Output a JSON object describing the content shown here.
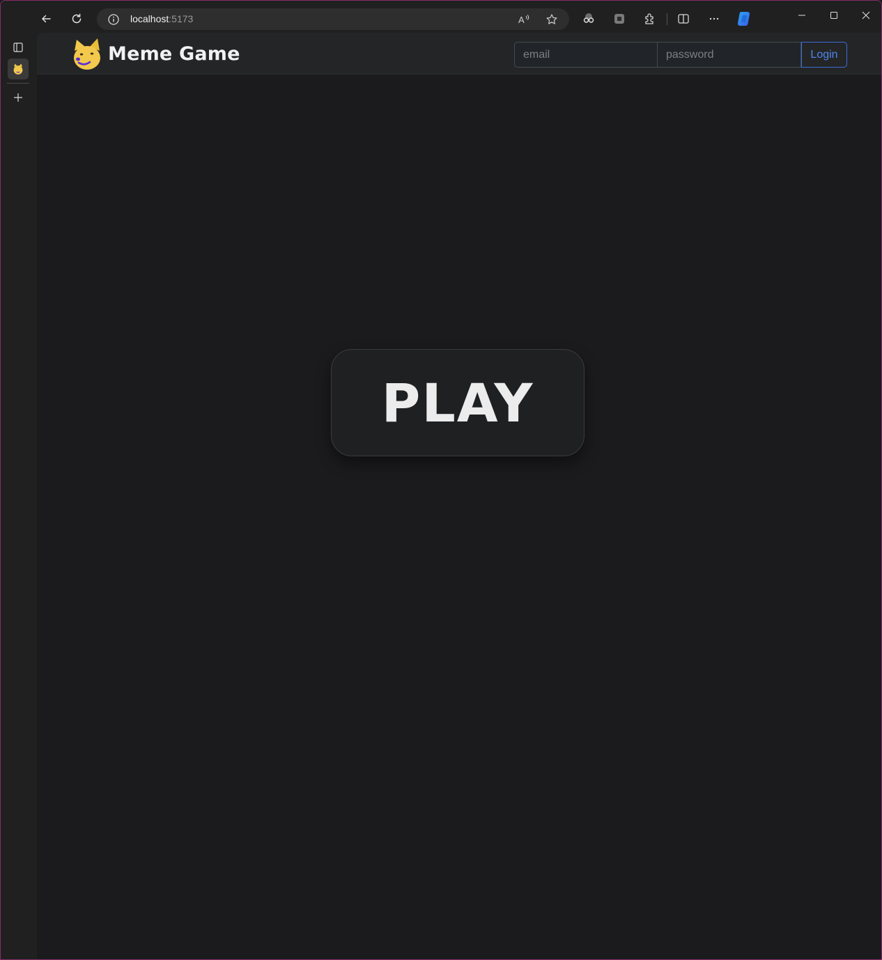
{
  "browser": {
    "url_host": "localhost",
    "url_port": ":5173"
  },
  "navbar": {
    "title": "Meme Game",
    "email_placeholder": "email",
    "password_placeholder": "password",
    "login_label": "Login"
  },
  "main": {
    "play_label": "PLAY"
  },
  "colors": {
    "page_bg": "#1b1b1d",
    "navbar_bg": "#242527",
    "login_accent": "#4f86f0",
    "logo_yellow": "#f2c94c"
  },
  "icons": [
    "back-arrow-icon",
    "refresh-icon",
    "info-icon",
    "read-aloud-icon",
    "favorite-star-icon",
    "extension-glasses-icon",
    "extension-puzzle-icon",
    "extensions-icon",
    "split-screen-icon",
    "more-options-icon",
    "copilot-icon",
    "minimize-icon",
    "maximize-icon",
    "close-icon",
    "tab-actions-icon",
    "meme-tab-favicon",
    "new-tab-plus-icon",
    "doge-logo-icon"
  ]
}
